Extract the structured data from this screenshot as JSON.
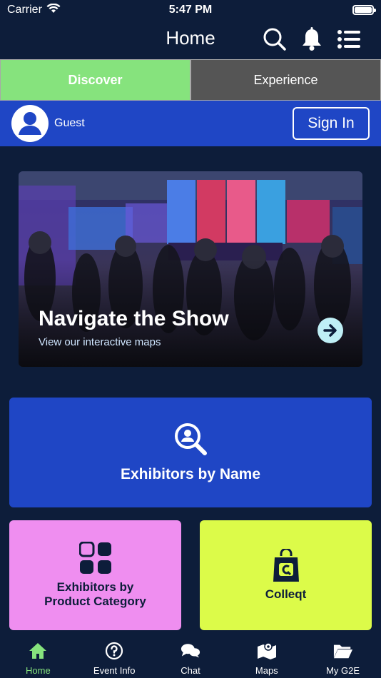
{
  "status_bar": {
    "carrier": "Carrier",
    "time": "5:47 PM"
  },
  "header": {
    "title": "Home",
    "icons": [
      "search-icon",
      "bell-icon",
      "list-menu-icon"
    ]
  },
  "tabs": [
    {
      "label": "Discover",
      "active": true
    },
    {
      "label": "Experience",
      "active": false
    }
  ],
  "user": {
    "name": "Guest",
    "sign_in_label": "Sign In"
  },
  "hero": {
    "title": "Navigate the Show",
    "subtitle": "View our interactive maps"
  },
  "cards": {
    "exhibitors_by_name": "Exhibitors by Name",
    "exhibitors_by_category": "Exhibitors by Product Category",
    "colleqt": "Colleqt"
  },
  "bottom_nav": [
    {
      "label": "Home",
      "icon": "home-icon",
      "active": true
    },
    {
      "label": "Event Info",
      "icon": "question-circle-icon",
      "active": false
    },
    {
      "label": "Chat",
      "icon": "chat-bubbles-icon",
      "active": false
    },
    {
      "label": "Maps",
      "icon": "map-icon",
      "active": false
    },
    {
      "label": "My G2E",
      "icon": "folder-icon",
      "active": false
    }
  ],
  "colors": {
    "background": "#0d1d3a",
    "accent_green": "#86e37d",
    "blue": "#1f46c5",
    "pink": "#ef8ef0",
    "lime": "#dcfb49"
  }
}
